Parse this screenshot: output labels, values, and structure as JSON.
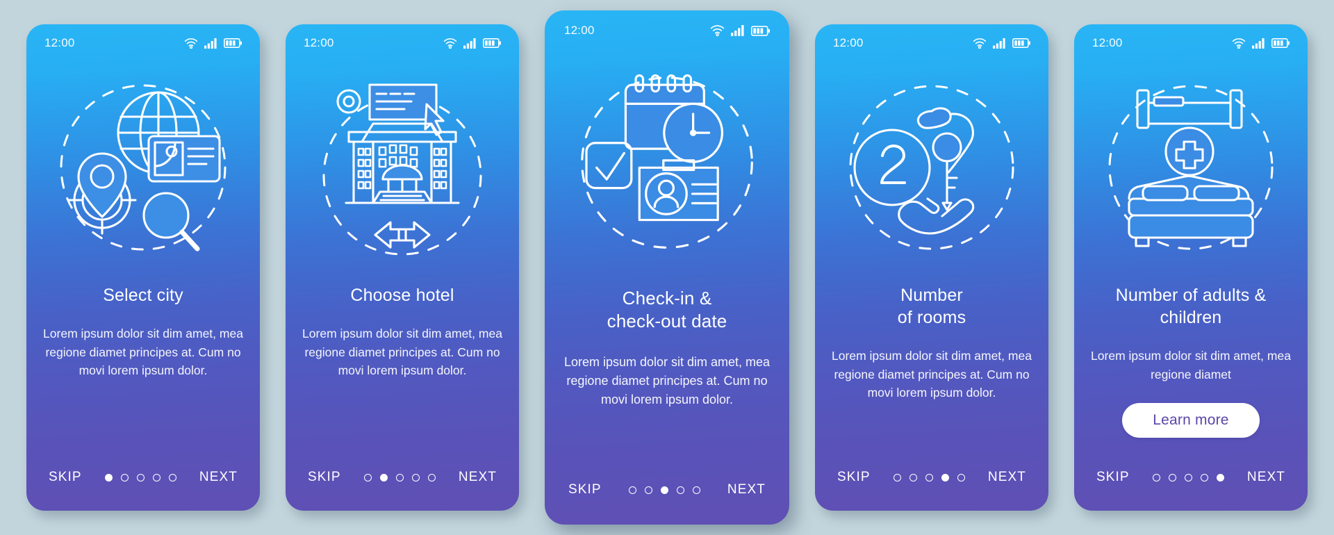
{
  "background_color": "#c3d5dc",
  "card_gradient": {
    "top": "#29b5f5",
    "bottom": "#5f50b4"
  },
  "status_bar": {
    "time": "12:00",
    "icons": [
      "wifi-icon",
      "cellular-signal-icon",
      "battery-icon"
    ]
  },
  "nav": {
    "skip_label": "SKIP",
    "next_label": "NEXT",
    "total_steps": 5
  },
  "screens": [
    {
      "id": "select-city",
      "illustration": "globe-location-id-card-search-illustration",
      "title": "Select city",
      "description": "Lorem ipsum dolor sit dim amet, mea regione diamet principes at. Cum no movi lorem ipsum dolor.",
      "active_dot": 1,
      "featured": false,
      "cta": null
    },
    {
      "id": "choose-hotel",
      "illustration": "hotel-building-cursor-arrows-illustration",
      "title": "Choose hotel",
      "description": "Lorem ipsum dolor sit dim amet, mea regione diamet principes at. Cum no movi lorem ipsum dolor.",
      "active_dot": 2,
      "featured": false,
      "cta": null
    },
    {
      "id": "check-in-check-out-date",
      "illustration": "calendar-clock-checkbox-badge-illustration",
      "title": "Check-in &\ncheck-out date",
      "description": "Lorem ipsum dolor sit dim amet, mea regione diamet principes at. Cum no movi lorem ipsum dolor.",
      "active_dot": 3,
      "featured": true,
      "cta": null
    },
    {
      "id": "number-of-rooms",
      "illustration": "number-two-key-in-hand-illustration",
      "title": "Number\nof rooms",
      "description": "Lorem ipsum dolor sit dim amet, mea regione diamet principes at. Cum no movi lorem ipsum dolor.",
      "active_dot": 4,
      "featured": false,
      "cta": null
    },
    {
      "id": "number-of-adults-children",
      "illustration": "single-bed-plus-double-bed-illustration",
      "title": "Number of adults &\nchildren",
      "description": "Lorem ipsum dolor sit dim amet, mea regione diamet",
      "active_dot": 5,
      "featured": false,
      "cta": {
        "label": "Learn more",
        "text_color": "#5a47a8",
        "background": "#ffffff"
      }
    }
  ]
}
